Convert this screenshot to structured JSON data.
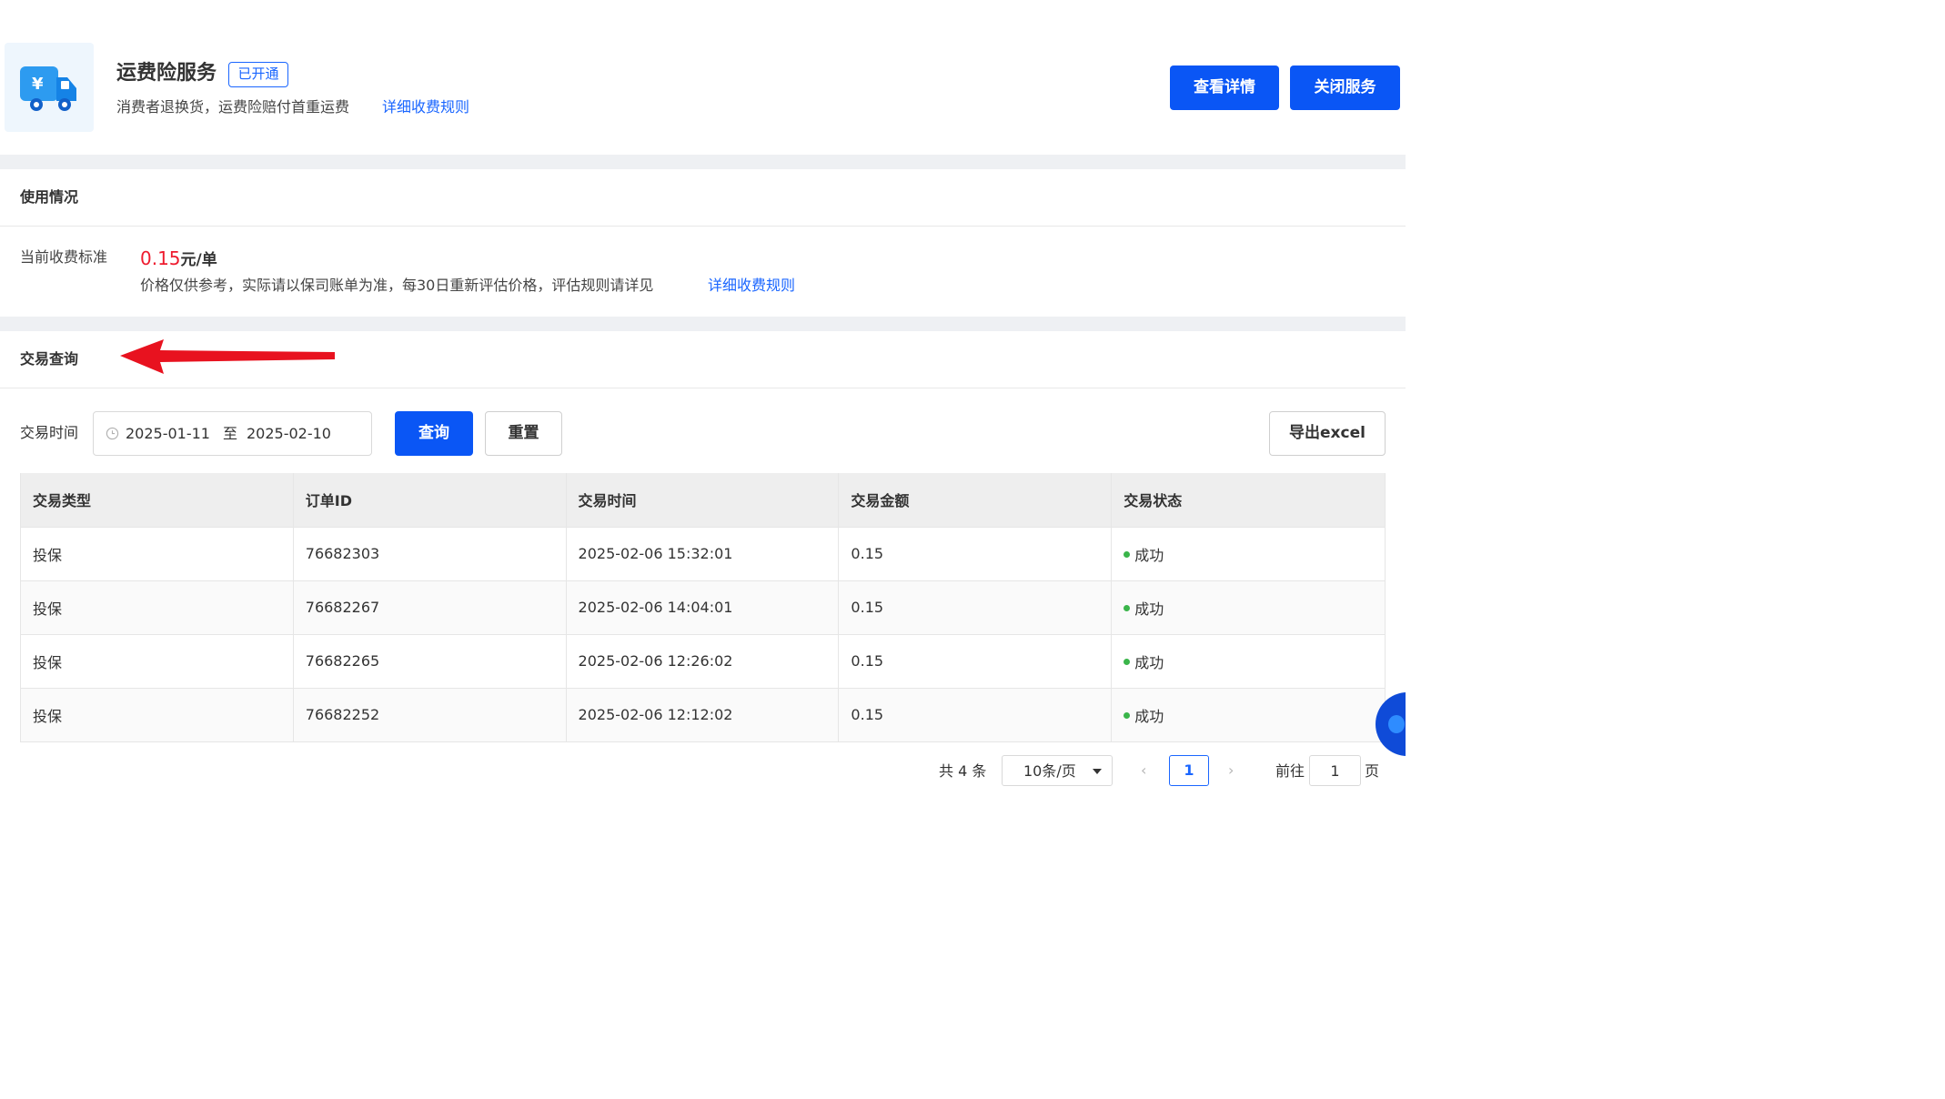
{
  "service": {
    "title": "运费险服务",
    "badge": "已开通",
    "description": "消费者退换货，运费险赔付首重运费",
    "rule_link": "详细收费规则",
    "logo_icon": "freight-truck-icon",
    "buttons": {
      "detail": "查看详情",
      "close": "关闭服务"
    }
  },
  "usage": {
    "section_title": "使用情况",
    "fee_label": "当前收费标准",
    "fee_amount": "0.15",
    "fee_unit": "元/单",
    "fee_note": "价格仅供参考，实际请以保司账单为准，每30日重新评估价格，评估规则请详见",
    "rule_link": "详细收费规则"
  },
  "query": {
    "section_title": "交易查询",
    "filter_label": "交易时间",
    "date_start": "2025-01-11 00:00:00",
    "date_separator": "至",
    "date_end": "2025-02-10",
    "buttons": {
      "query": "查询",
      "reset": "重置",
      "export": "导出excel"
    }
  },
  "table": {
    "columns": [
      "交易类型",
      "订单ID",
      "交易时间",
      "交易金额",
      "交易状态"
    ],
    "rows": [
      {
        "type": "投保",
        "order_id": "76682303",
        "time": "2025-02-06 15:32:01",
        "amount": "0.15",
        "status": "成功"
      },
      {
        "type": "投保",
        "order_id": "76682267",
        "time": "2025-02-06 14:04:01",
        "amount": "0.15",
        "status": "成功"
      },
      {
        "type": "投保",
        "order_id": "76682265",
        "time": "2025-02-06 12:26:02",
        "amount": "0.15",
        "status": "成功"
      },
      {
        "type": "投保",
        "order_id": "76682252",
        "time": "2025-02-06 12:12:02",
        "amount": "0.15",
        "status": "成功"
      }
    ]
  },
  "pagination": {
    "total": "共 4 条",
    "page_size": "10条/页",
    "prev": "‹",
    "next": "›",
    "current_page": "1",
    "goto_label": "前往",
    "goto_value": "1",
    "page_suffix": "页"
  },
  "colors": {
    "primary": "#0a56f5",
    "link": "#1a66ff",
    "fee_red": "#ee1b2e",
    "success": "#3ab54a",
    "annotation_arrow": "#e8121f"
  }
}
